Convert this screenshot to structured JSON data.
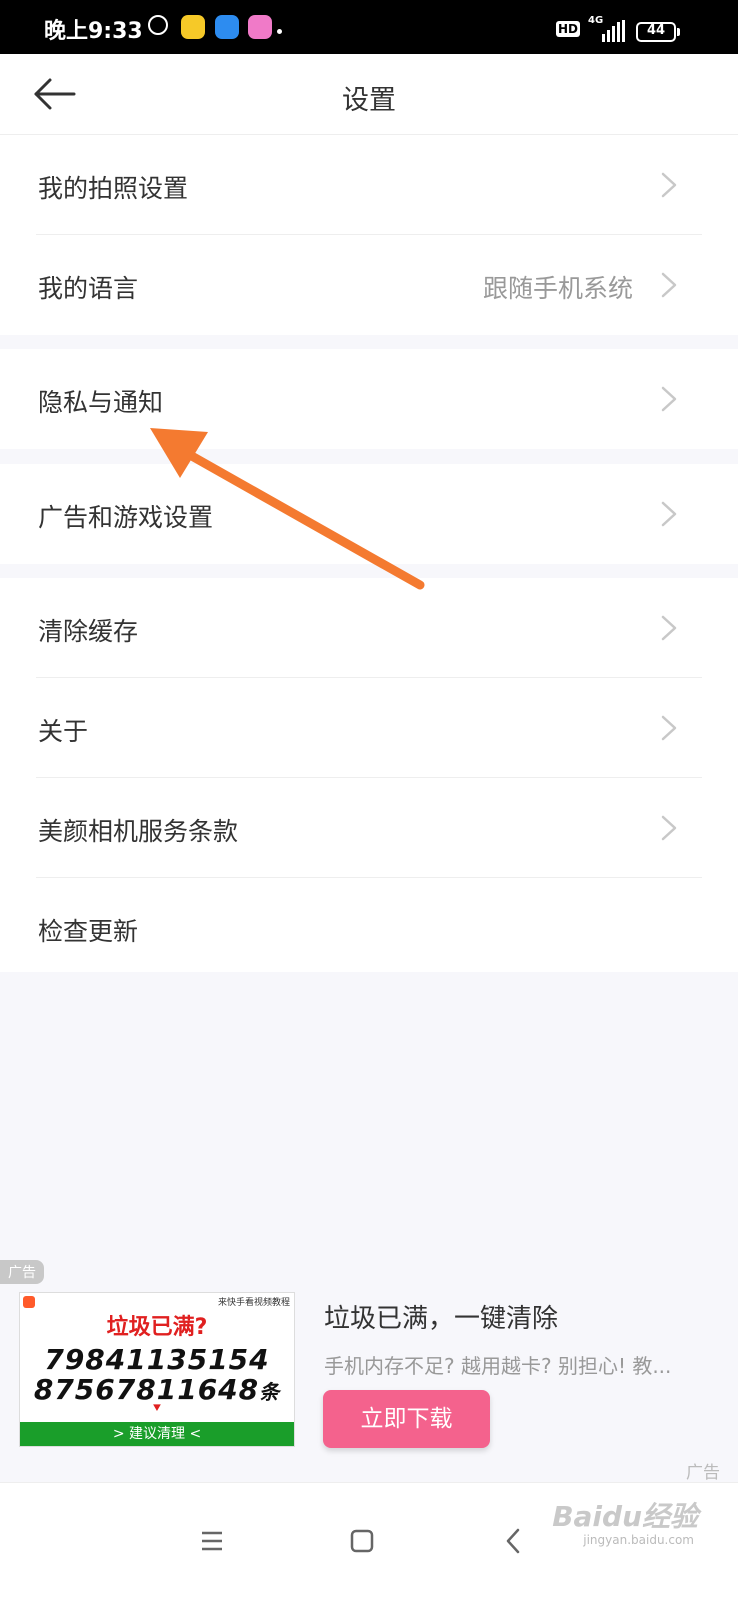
{
  "status_bar": {
    "time": "晚上9:33",
    "network": "4G",
    "hd": "HD",
    "battery": "44",
    "battery_level": 0.44,
    "icons": [
      "alarm-icon",
      "green-app-icon",
      "cloud-app-icon",
      "pink-app-icon"
    ]
  },
  "header": {
    "title": "设置"
  },
  "groups": [
    {
      "items": [
        {
          "label": "我的拍照设置",
          "value": "",
          "chevron": true
        },
        {
          "label": "我的语言",
          "value": "跟随手机系统",
          "chevron": true
        }
      ]
    },
    {
      "items": [
        {
          "label": "隐私与通知",
          "value": "",
          "chevron": true
        }
      ]
    },
    {
      "items": [
        {
          "label": "广告和游戏设置",
          "value": "",
          "chevron": true
        }
      ]
    },
    {
      "items": [
        {
          "label": "清除缓存",
          "value": "",
          "chevron": true
        },
        {
          "label": "关于",
          "value": "",
          "chevron": true
        },
        {
          "label": "美颜相机服务条款",
          "value": "",
          "chevron": true
        },
        {
          "label": "检查更新",
          "value": "",
          "chevron": false
        }
      ]
    }
  ],
  "ad": {
    "badge": "广告",
    "image": {
      "top_text": "来快手看视频教程",
      "headline": "垃圾已满?",
      "number1": "79841135154",
      "number2": "87567811648",
      "number2_suffix": "条",
      "cta": "> 建议清理 <"
    },
    "title": "垃圾已满，一键清除",
    "description": "手机内存不足? 越用越卡? 别担心! 教...",
    "button": "立即下载",
    "corner_label": "广告"
  },
  "watermark": {
    "text": "Baidu经验",
    "sub": "jingyan.baidu.com"
  },
  "colors": {
    "ad_button": "#f4628d",
    "annotation_arrow": "#f47a30",
    "ad_cta_bar": "#1a9e2a",
    "ad_headline": "#e02020"
  }
}
